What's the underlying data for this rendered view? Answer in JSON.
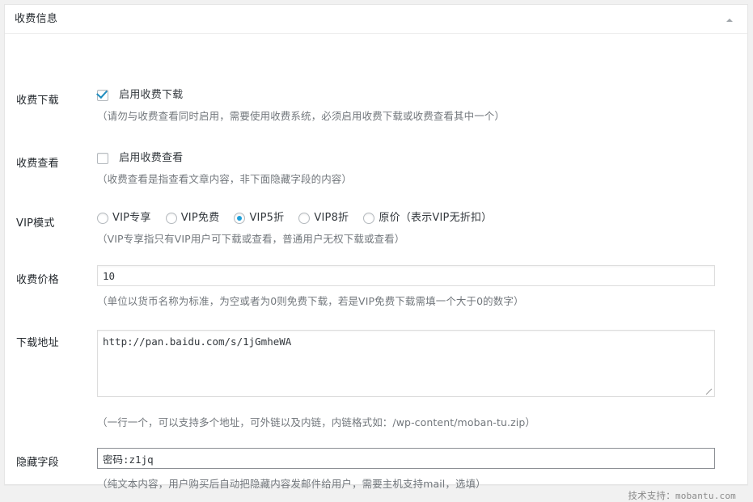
{
  "panel": {
    "title": "收费信息",
    "toggle_icon": "chevron-up-icon"
  },
  "rows": {
    "paid_download": {
      "label": "收费下载",
      "checkbox_label": "启用收费下载",
      "checked": true,
      "description": "（请勿与收费查看同时启用，需要使用收费系统，必须启用收费下载或收费查看其中一个）"
    },
    "paid_view": {
      "label": "收费查看",
      "checkbox_label": "启用收费查看",
      "checked": false,
      "description": "（收费查看是指查看文章内容，非下面隐藏字段的内容）"
    },
    "vip_mode": {
      "label": "VIP模式",
      "options": [
        {
          "label": "VIP专享",
          "selected": false
        },
        {
          "label": "VIP免费",
          "selected": false
        },
        {
          "label": "VIP5折",
          "selected": true
        },
        {
          "label": "VIP8折",
          "selected": false
        },
        {
          "label": "原价（表示VIP无折扣）",
          "selected": false
        }
      ],
      "description": "（VIP专享指只有VIP用户可下载或查看，普通用户无权下载或查看）"
    },
    "price": {
      "label": "收费价格",
      "value": "10",
      "placeholder": "",
      "description": "（单位以货币名称为标准，为空或者为0则免费下载，若是VIP免费下载需填一个大于0的数字）"
    },
    "download_url": {
      "label": "下载地址",
      "value": "http://pan.baidu.com/s/1jGmheWA",
      "placeholder": "",
      "description": "（一行一个，可以支持多个地址，可外链以及内链，内链格式如：/wp-content/moban-tu.zip）"
    },
    "hidden_field": {
      "label": "隐藏字段",
      "value": "密码:z1jq",
      "placeholder": "",
      "description": "（纯文本内容，用户购买后自动把隐藏内容发邮件给用户，需要主机支持mail，选填）"
    }
  },
  "footer": {
    "credit_prefix": "技术支持：",
    "credit_site": "mobantu.com"
  },
  "colors": {
    "accent": "#1e8cbe",
    "radio_accent": "#1e9fd8",
    "panel_bg": "#ffffff",
    "page_bg": "#f1f1f1",
    "border": "#e5e5e5",
    "text": "#23282d",
    "desc_text": "#72777c"
  }
}
